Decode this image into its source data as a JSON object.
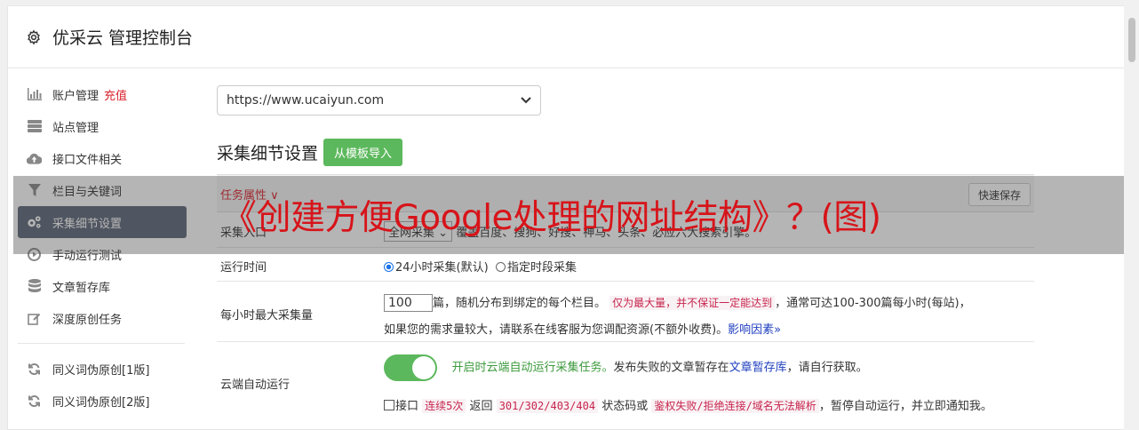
{
  "header": {
    "title": "优采云 管理控制台",
    "icon": "gear-icon"
  },
  "sidebar": {
    "items": [
      {
        "label": "账户管理",
        "extra": "充值",
        "icon": "bar-chart-icon",
        "active": false
      },
      {
        "label": "站点管理",
        "icon": "server-icon",
        "active": false
      },
      {
        "label": "接口文件相关",
        "icon": "cloud-upload-icon",
        "active": false
      },
      {
        "label": "栏目与关键词",
        "icon": "filter-icon",
        "active": false
      },
      {
        "label": "采集细节设置",
        "icon": "cogs-icon",
        "active": true
      },
      {
        "label": "手动运行测试",
        "icon": "play-circle-icon",
        "active": false
      },
      {
        "label": "文章暂存库",
        "icon": "database-icon",
        "active": false
      },
      {
        "label": "深度原创任务",
        "icon": "edit-icon",
        "active": false
      },
      {
        "label": "同义词伪原创[1版]",
        "icon": "refresh-icon",
        "active": false
      },
      {
        "label": "同义词伪原创[2版]",
        "icon": "refresh-icon",
        "active": false
      }
    ]
  },
  "main": {
    "site_select": "https://www.ucaiyun.com",
    "section_title": "采集细节设置",
    "import_button": "从模板导入",
    "table_header": {
      "label": "任务属性 ∨",
      "save": "快速保存"
    },
    "rows": {
      "source": {
        "label": "采集入口",
        "select": "全网采集",
        "desc": "覆盖百度、搜狗、好搜、神马、头条、必应六大搜索引擎。"
      },
      "runtime": {
        "label": "运行时间",
        "opt1": "24小时采集(默认)",
        "opt2": "指定时段采集"
      },
      "max_per_hour": {
        "label": "每小时最大采集量",
        "value": "100",
        "text1": "篇，随机分布到绑定的每个栏目。",
        "warn": "仅为最大量，并不保证一定能达到",
        "text2": "，通常可达100-300篇每小时(每站)，",
        "text3": "如果您的需求量较大，请联系在线客服为您调配资源(不额外收费)。",
        "link": "影响因素",
        "link_icon": "double-chevron-down-icon"
      },
      "cloud_run": {
        "label": "云端自动运行",
        "toggle_on": true,
        "green": "开启时云端自动运行采集任务。",
        "text1": "发布失败的文章暂存在",
        "link": "文章暂存库",
        "text2": "，请自行获取。",
        "cb_label": "接口",
        "code1": "连续5次",
        "text3": "返回",
        "code2": "301/302/403/404",
        "text4": "状态码或",
        "code3": "鉴权失败/拒绝连接/域名无法解析",
        "text5": "，暂停自动运行，并立即通知我。"
      }
    }
  },
  "overlay": {
    "text": "《创建方便Google处理的网址结构》？(图)"
  },
  "colors": {
    "accent_green": "#5cb85c",
    "active_nav": "#5d6678",
    "warn_red": "#d9232d",
    "overlay_text": "#d7141a"
  }
}
